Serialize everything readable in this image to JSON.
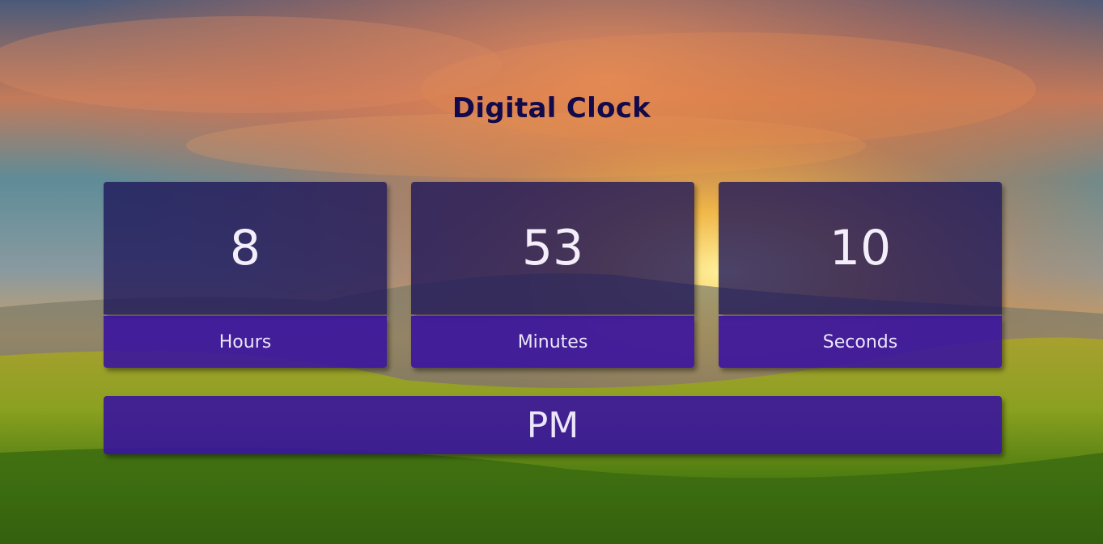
{
  "page": {
    "title": "Digital Clock"
  },
  "clock": {
    "hours": {
      "value": "8",
      "label": "Hours"
    },
    "minutes": {
      "value": "53",
      "label": "Minutes"
    },
    "seconds": {
      "value": "10",
      "label": "Seconds"
    },
    "period": "PM"
  },
  "colors": {
    "title": "#120a4a",
    "value_box": "#1e165a",
    "label_box": "#3810a0",
    "text": "#f3eefa"
  }
}
